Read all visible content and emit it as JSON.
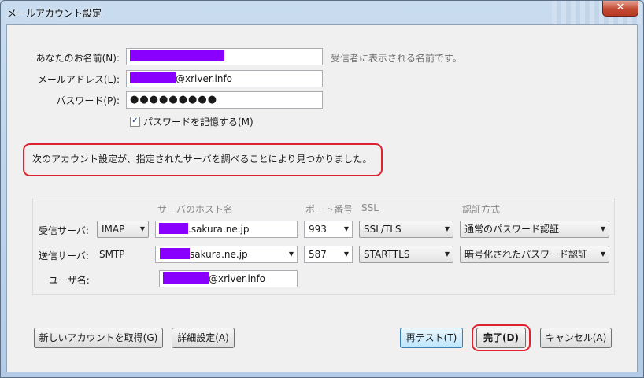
{
  "window": {
    "title": "メールアカウント設定",
    "close_glyph": "✕"
  },
  "form": {
    "name_label": "あなたのお名前(N):",
    "name_hint": "受信者に表示される名前です。",
    "email_label": "メールアドレス(L):",
    "email_suffix": "@xriver.info",
    "password_label": "パスワード(P):",
    "password_value": "●●●●●●●●●",
    "remember_password_label": "パスワードを記憶する(M)",
    "remember_password_checked": "✓"
  },
  "notice": "次のアカウント設定が、指定されたサーバを調べることにより見つかりました。",
  "server": {
    "headers": {
      "host": "サーバのホスト名",
      "port": "ポート番号",
      "ssl": "SSL",
      "auth": "認証方式"
    },
    "incoming": {
      "label": "受信サーバ:",
      "protocol": "IMAP",
      "host_suffix": ".sakura.ne.jp",
      "port": "993",
      "ssl": "SSL/TLS",
      "auth": "通常のパスワード認証"
    },
    "outgoing": {
      "label": "送信サーバ:",
      "protocol": "SMTP",
      "host_suffix": "sakura.ne.jp",
      "port": "587",
      "ssl": "STARTTLS",
      "auth": "暗号化されたパスワード認証"
    },
    "username": {
      "label": "ユーザ名:",
      "suffix": "@xriver.info"
    }
  },
  "buttons": {
    "new_account": "新しいアカウントを取得(G)",
    "advanced": "詳細設定(A)",
    "retest": "再テスト(T)",
    "done": "完了(D)",
    "cancel": "キャンセル(A)"
  },
  "colors": {
    "redaction": "#8a00ff",
    "highlight": "#e0212e"
  }
}
